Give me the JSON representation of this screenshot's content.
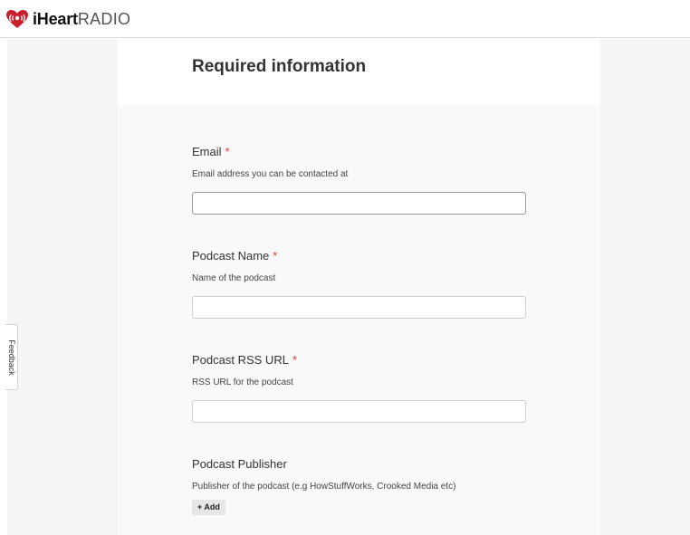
{
  "brand": {
    "logo_icon": "iheart-logo-icon",
    "name_bold": "iHeart",
    "name_light": "RADIO",
    "color": "#cc1f2d"
  },
  "form": {
    "title": "Required information",
    "fields": [
      {
        "label": "Email",
        "required_mark": "*",
        "help": "Email address you can be contacted at",
        "value": "",
        "placeholder": ""
      },
      {
        "label": "Podcast Name",
        "required_mark": "*",
        "help": "Name of the podcast",
        "value": "",
        "placeholder": ""
      },
      {
        "label": "Podcast RSS URL",
        "required_mark": "*",
        "help": "RSS URL for the podcast",
        "value": "",
        "placeholder": ""
      },
      {
        "label": "Podcast Publisher",
        "help": "Publisher of the podcast (e.g HowStuffWorks, Crooked Media etc)",
        "add_label": "+ Add"
      }
    ]
  },
  "feedback": {
    "label": "Feedback"
  },
  "colors": {
    "required": "#e1403a",
    "page_bg": "#f5f5f5",
    "card_bg": "#f9f9f9"
  }
}
